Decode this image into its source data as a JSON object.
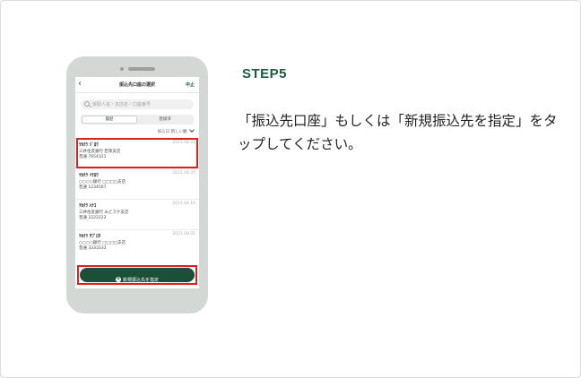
{
  "step": {
    "label": "STEP5"
  },
  "instruction": {
    "text": "「振込先口座」もしくは「新規振込先を指定」をタップしてください。"
  },
  "phone": {
    "nav": {
      "back_icon": "chevron-left-icon",
      "title": "振込先口座の選択",
      "cancel": "中止"
    },
    "search": {
      "placeholder": "受取人名・支店名・口座番号",
      "icon": "search-icon"
    },
    "tabs": [
      {
        "label": "履歴"
      },
      {
        "label": "登録済"
      }
    ],
    "sort": {
      "label": "振込日",
      "value": "新しい順"
    },
    "items": [
      {
        "name": "ﾂｶｸﾗ ｼﾞﾛｳ",
        "date": "2021.08.31",
        "bank": "三井住友銀行 若草支店",
        "account": "普通 7654321"
      },
      {
        "name": "ﾂｶｸﾗ ｲﾁﾛｳ",
        "date": "2021.08.20",
        "bank": "○○○○銀行 □□□□支店",
        "account": "普通 1234567"
      },
      {
        "name": "ﾂｶｸﾗ ﾊﾅｺ",
        "date": "2021.08.10",
        "bank": "三井住友銀行 みどスケ支店",
        "account": "普通 2222222"
      },
      {
        "name": "ﾂｶｸﾗ ｻﾌﾞﾛｳ",
        "date": "2021.08.01",
        "bank": "○○○○銀行 □□□□支店",
        "account": "普通 3333333"
      }
    ],
    "new_button": {
      "label": "新規振込先を指定",
      "icon": "plus-circle-icon"
    }
  },
  "colors": {
    "brand_green": "#1c4f38",
    "highlight_red": "#e0201c"
  }
}
